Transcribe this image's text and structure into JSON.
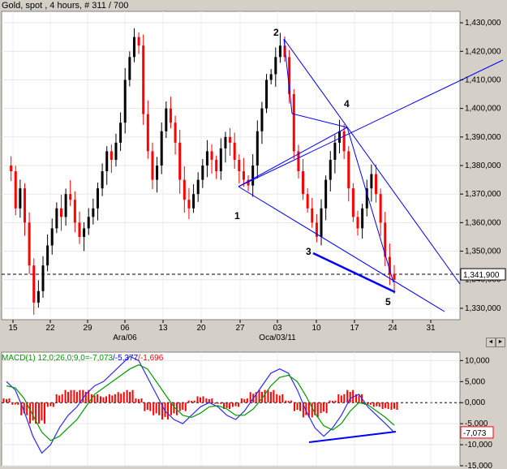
{
  "title": "Gold, spot , 4 hours, # 311 / 700",
  "main": {
    "price_tag": "1,341,900",
    "y_ticks": [
      "1,430,000",
      "1,420,000",
      "1,410,000",
      "1,400,000",
      "1,390,000",
      "1,380,000",
      "1,370,000",
      "1,360,000",
      "1,350,000",
      "1,340,000",
      "1,330,000"
    ],
    "x_ticks": [
      "15",
      "22",
      "29",
      "06",
      "13",
      "20",
      "27",
      "03",
      "10",
      "17",
      "24",
      "31"
    ],
    "month_labels": [
      "Ara/06",
      "Oca/03/11"
    ],
    "wave_labels": [
      "1",
      "2",
      "3",
      "4",
      "5"
    ]
  },
  "macd": {
    "prefix": "MACD(1) 12,0;26,0;9,0=",
    "macd_value": "-7,073",
    "signal_value": "/-5,377",
    "hist_value": "/-1,696",
    "y_ticks": [
      "10,000",
      "5,000",
      "0,000",
      "-5,000",
      "-10,000",
      "-15,000"
    ],
    "tag": "-7,073"
  },
  "nav": {
    "left": "◄",
    "right": "►"
  },
  "colors": {
    "up": "#000000",
    "down": "#ff0000",
    "trend": "#0000ff",
    "macd": "#2b2bff",
    "signal": "#009900",
    "hist": "#ff0000"
  },
  "chart_data": [
    {
      "type": "candlestick",
      "title": "Gold, spot , 4 hours, # 311 / 700",
      "ylim": [
        1326000,
        1434000
      ],
      "x": [
        "15",
        "22",
        "29",
        "06",
        "13",
        "20",
        "27",
        "03",
        "10",
        "17",
        "24",
        "31"
      ],
      "close_path": [
        1380000,
        1378000,
        1365000,
        1372000,
        1360000,
        1345000,
        1332000,
        1336000,
        1345000,
        1352000,
        1358000,
        1365000,
        1362000,
        1370000,
        1368000,
        1360000,
        1355000,
        1358000,
        1362000,
        1365000,
        1372000,
        1378000,
        1385000,
        1382000,
        1388000,
        1395000,
        1410000,
        1418000,
        1425000,
        1422000,
        1398000,
        1385000,
        1375000,
        1380000,
        1392000,
        1400000,
        1395000,
        1388000,
        1375000,
        1368000,
        1365000,
        1370000,
        1375000,
        1380000,
        1385000,
        1382000,
        1378000,
        1386000,
        1390000,
        1388000,
        1382000,
        1378000,
        1375000,
        1373000,
        1380000,
        1392000,
        1400000,
        1410000,
        1412000,
        1418000,
        1422000,
        1418000,
        1405000,
        1385000,
        1378000,
        1370000,
        1365000,
        1360000,
        1355000,
        1365000,
        1375000,
        1382000,
        1388000,
        1392000,
        1385000,
        1372000,
        1362000,
        1358000,
        1365000,
        1372000,
        1377000,
        1370000,
        1360000,
        1348000,
        1342000,
        1340000
      ],
      "last_price": 1341900,
      "annotations": [
        "1",
        "2",
        "3",
        "4",
        "5"
      ]
    },
    {
      "type": "line",
      "title": "MACD(1) 12,0;26,0;9,0",
      "ylim": [
        -15000,
        12000
      ],
      "series": [
        {
          "name": "MACD",
          "values": [
            5000,
            3000,
            -2000,
            -8000,
            -12000,
            -10000,
            -6000,
            -3000,
            -1000,
            2000,
            4000,
            5000,
            7000,
            9000,
            11000,
            10000,
            6000,
            2000,
            -2000,
            -4000,
            -5000,
            -3000,
            -1000,
            0,
            -1000,
            -3000,
            -4000,
            -2000,
            1000,
            4000,
            7000,
            8000,
            7000,
            3000,
            -2000,
            -6000,
            -8000,
            -6000,
            -3000,
            1000,
            2000,
            -1000,
            -3000,
            -5000,
            -7073
          ]
        },
        {
          "name": "Signal",
          "values": [
            4000,
            3500,
            1000,
            -3000,
            -7000,
            -9000,
            -8000,
            -6000,
            -4000,
            -1000,
            2000,
            3500,
            5000,
            6500,
            8000,
            9000,
            8000,
            5000,
            2000,
            -1000,
            -3000,
            -3500,
            -2500,
            -1000,
            -700,
            -1500,
            -3000,
            -3000,
            -1500,
            1000,
            4000,
            6000,
            6500,
            5000,
            1500,
            -2500,
            -5500,
            -6500,
            -5000,
            -2000,
            0,
            -500,
            -2000,
            -3500,
            -5377
          ]
        },
        {
          "name": "Histogram",
          "values": [
            1000,
            -500,
            -3000,
            -5000,
            -5000,
            -1000,
            2000,
            3000,
            3000,
            3000,
            2000,
            1500,
            2000,
            2500,
            3000,
            1000,
            -2000,
            -3000,
            -4000,
            -3000,
            -2000,
            500,
            1500,
            1000,
            -300,
            -1500,
            -1000,
            1000,
            2500,
            3000,
            3000,
            2000,
            500,
            -2000,
            -3500,
            -3500,
            -2500,
            500,
            2000,
            3000,
            2000,
            -500,
            -1000,
            -1500,
            -1696
          ]
        }
      ]
    }
  ]
}
